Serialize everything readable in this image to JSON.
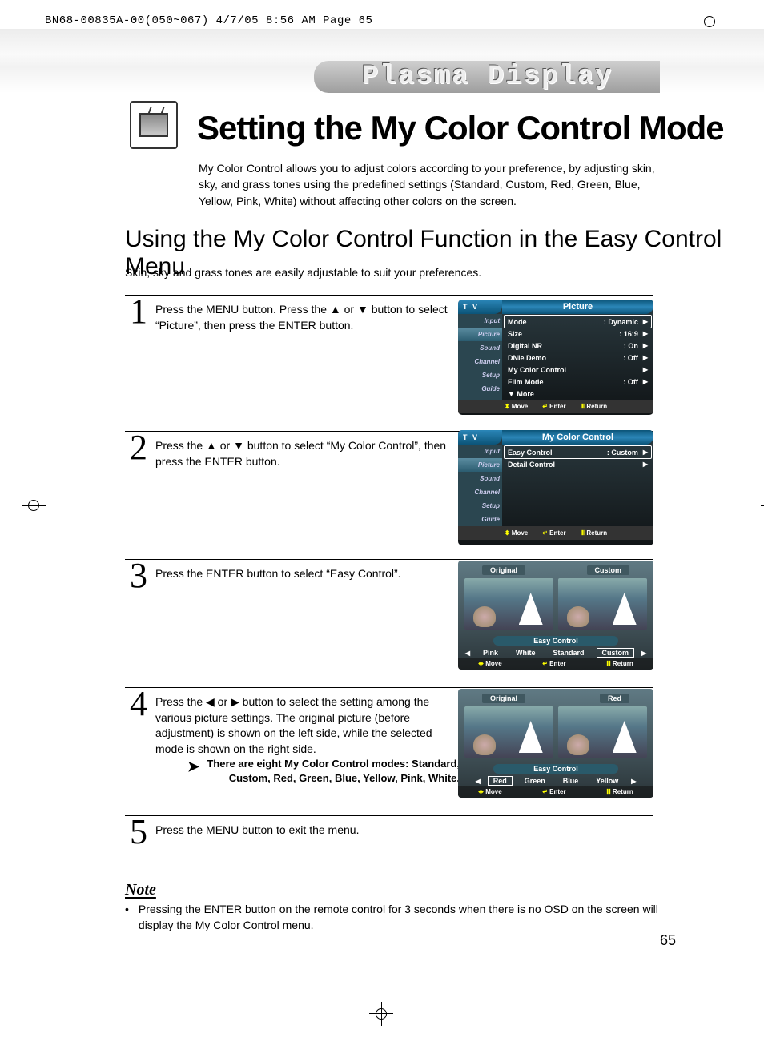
{
  "print_header": "BN68-00835A-00(050~067)  4/7/05  8:56 AM  Page 65",
  "banner": "Plasma Display",
  "page_title": "Setting the My Color Control Mode",
  "intro": "My Color Control allows you to adjust colors according to your preference, by adjusting skin, sky, and grass tones using the predefined settings (Standard, Custom, Red, Green, Blue, Yellow, Pink, White) without affecting other colors on the screen.",
  "subheading": "Using the My Color Control Function in the Easy Control Menu",
  "sub_desc": "Skin, sky and grass tones are easily adjustable to suit your preferences.",
  "steps": [
    {
      "n": "1",
      "text": "Press the MENU button. Press the ▲ or ▼ button to select “Picture”, then press the ENTER button."
    },
    {
      "n": "2",
      "text": "Press the ▲ or ▼ button to select “My Color Control”, then press the ENTER button."
    },
    {
      "n": "3",
      "text": "Press the ENTER button to select “Easy Control”."
    },
    {
      "n": "4",
      "text": "Press the ◀ or ▶ button to select the setting among the various picture settings. The original picture (before adjustment) is shown on the left side, while the selected mode is shown on the right side.",
      "tip": "There are eight My Color Control modes: Standard, Custom, Red, Green, Blue, Yellow, Pink, White."
    },
    {
      "n": "5",
      "text": "Press the MENU button to exit the menu."
    }
  ],
  "note_label": "Note",
  "note_text": "Pressing the ENTER button on the remote control for 3 seconds when there is no OSD on the screen will display the My Color Control menu.",
  "page_number": "65",
  "osd1": {
    "tv_label": "T V",
    "title": "Picture",
    "sidebar": [
      "Input",
      "Picture",
      "Sound",
      "Channel",
      "Setup",
      "Guide"
    ],
    "rows": [
      {
        "label": "Mode",
        "value": ": Dynamic",
        "sel": true
      },
      {
        "label": "Size",
        "value": ": 16:9"
      },
      {
        "label": "Digital NR",
        "value": ": On"
      },
      {
        "label": "DNIe Demo",
        "value": ": Off"
      },
      {
        "label": "My Color Control",
        "value": ""
      },
      {
        "label": "Film Mode",
        "value": ": Off"
      },
      {
        "label": "▼ More",
        "value": "",
        "noarr": true
      }
    ],
    "footer": {
      "move": "Move",
      "enter": "Enter",
      "ret": "Return"
    }
  },
  "osd2": {
    "tv_label": "T V",
    "title": "My Color Control",
    "sidebar": [
      "Input",
      "Picture",
      "Sound",
      "Channel",
      "Setup",
      "Guide"
    ],
    "rows": [
      {
        "label": "Easy Control",
        "value": ": Custom",
        "sel": true
      },
      {
        "label": "Detail Control",
        "value": ""
      }
    ],
    "footer": {
      "move": "Move",
      "enter": "Enter",
      "ret": "Return"
    }
  },
  "ecp1": {
    "left": "Original",
    "right": "Custom",
    "mid": "Easy Control",
    "chips": [
      "Pink",
      "White",
      "Standard",
      "Custom"
    ],
    "sel": 3,
    "footer": {
      "move": "Move",
      "enter": "Enter",
      "ret": "Return"
    }
  },
  "ecp2": {
    "left": "Original",
    "right": "Red",
    "mid": "Easy Control",
    "chips": [
      "Red",
      "Green",
      "Blue",
      "Yellow"
    ],
    "sel": 0,
    "footer": {
      "move": "Move",
      "enter": "Enter",
      "ret": "Return"
    }
  }
}
